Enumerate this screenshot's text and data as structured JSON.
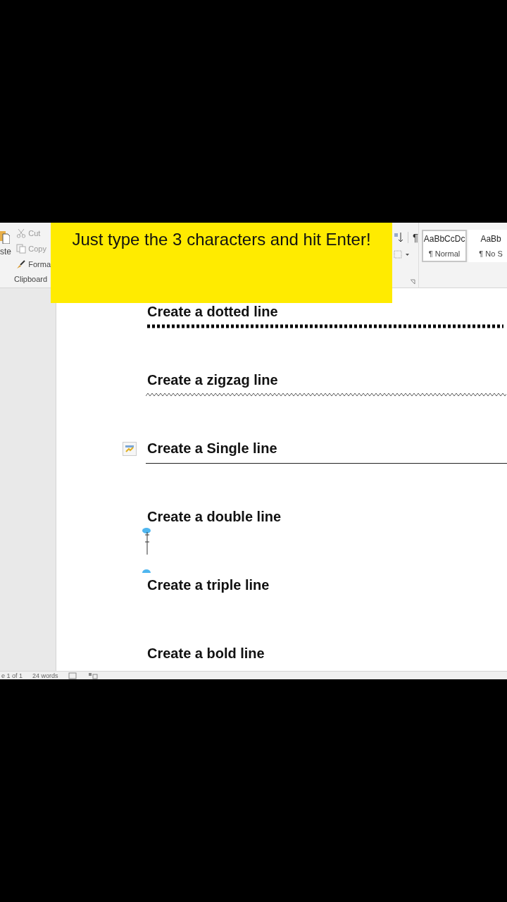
{
  "ribbon": {
    "paste_label": "ste",
    "clipboard_items": [
      {
        "label": "Cut",
        "kind": "cut"
      },
      {
        "label": "Copy",
        "kind": "copy"
      },
      {
        "label": "Forma",
        "kind": "format"
      }
    ],
    "clipboard_group": "Clipboard",
    "pilcrow": "¶",
    "styles": [
      {
        "sample": "AaBbCcDc",
        "name": "¶ Normal",
        "selected": true
      },
      {
        "sample": "AaBb",
        "name": "¶ No S",
        "selected": false
      }
    ]
  },
  "banner": {
    "text": "Just type the 3 characters and hit Enter!"
  },
  "document": {
    "sections": [
      {
        "heading": "Create a dotted line",
        "kind": "dotted"
      },
      {
        "heading": "Create a zigzag line",
        "kind": "zigzag"
      },
      {
        "heading": "Create a Single line",
        "kind": "single",
        "smart_tag": true
      },
      {
        "heading": "Create a double line",
        "kind": "plain",
        "cursor": true
      },
      {
        "heading": "Create a triple line",
        "kind": "plain"
      },
      {
        "heading": "Create a bold line",
        "kind": "plain"
      }
    ]
  },
  "status_bar": {
    "page": "e 1 of 1",
    "words": "24 words"
  }
}
